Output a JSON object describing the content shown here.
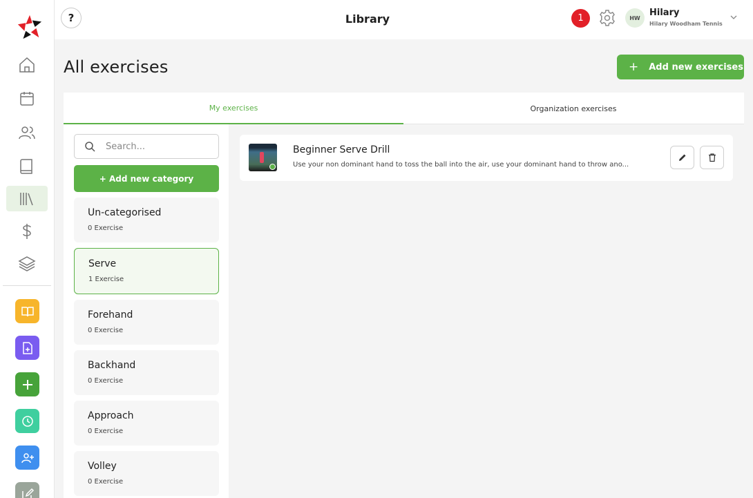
{
  "header": {
    "title": "Library",
    "help_label": "?",
    "notifications_count": "1",
    "user": {
      "initials": "HW",
      "name": "Hilary",
      "organization": "Hilary Woodham Tennis"
    }
  },
  "sidebar": {
    "nav": [
      {
        "name": "home",
        "icon": "home-icon"
      },
      {
        "name": "calendar",
        "icon": "calendar-icon"
      },
      {
        "name": "users",
        "icon": "users-icon"
      },
      {
        "name": "book",
        "icon": "book-icon"
      },
      {
        "name": "library",
        "icon": "library-icon",
        "active": true
      },
      {
        "name": "billing",
        "icon": "dollar-icon"
      },
      {
        "name": "layers",
        "icon": "layers-icon"
      }
    ],
    "quick_actions": [
      {
        "name": "open-book",
        "icon": "open-book-icon",
        "color": "#f7b52b"
      },
      {
        "name": "add-document",
        "icon": "document-plus-icon",
        "color": "#7a5cf0"
      },
      {
        "name": "add",
        "icon": "plus-icon",
        "color": "#47a33a"
      },
      {
        "name": "clock",
        "icon": "clock-icon",
        "color": "#3fcf9f"
      },
      {
        "name": "add-user",
        "icon": "user-plus-icon",
        "color": "#3f8fef"
      },
      {
        "name": "edit",
        "icon": "pencil-square-icon",
        "color": "#9aa59a"
      }
    ]
  },
  "main": {
    "title": "All exercises",
    "add_exercise_label": "Add new exercises",
    "add_exercise_plus": "+",
    "tabs": [
      {
        "label": "My exercises",
        "active": true
      },
      {
        "label": "Organization exercises",
        "active": false
      }
    ],
    "search": {
      "placeholder": "Search...",
      "value": ""
    },
    "add_category_label": "+ Add new category",
    "categories": [
      {
        "name": "Un-categorised",
        "count": "0 Exercise"
      },
      {
        "name": "Serve",
        "count": "1 Exercise",
        "selected": true
      },
      {
        "name": "Forehand",
        "count": "0 Exercise"
      },
      {
        "name": "Backhand",
        "count": "0 Exercise"
      },
      {
        "name": "Approach",
        "count": "0 Exercise"
      },
      {
        "name": "Volley",
        "count": "0 Exercise"
      }
    ],
    "exercises": [
      {
        "title": "Beginner Serve Drill",
        "description": "Use your non dominant hand to toss the ball into the air, use your dominant hand to throw ano..."
      }
    ]
  },
  "colors": {
    "accent": "#5cb247",
    "danger": "#e22028"
  }
}
